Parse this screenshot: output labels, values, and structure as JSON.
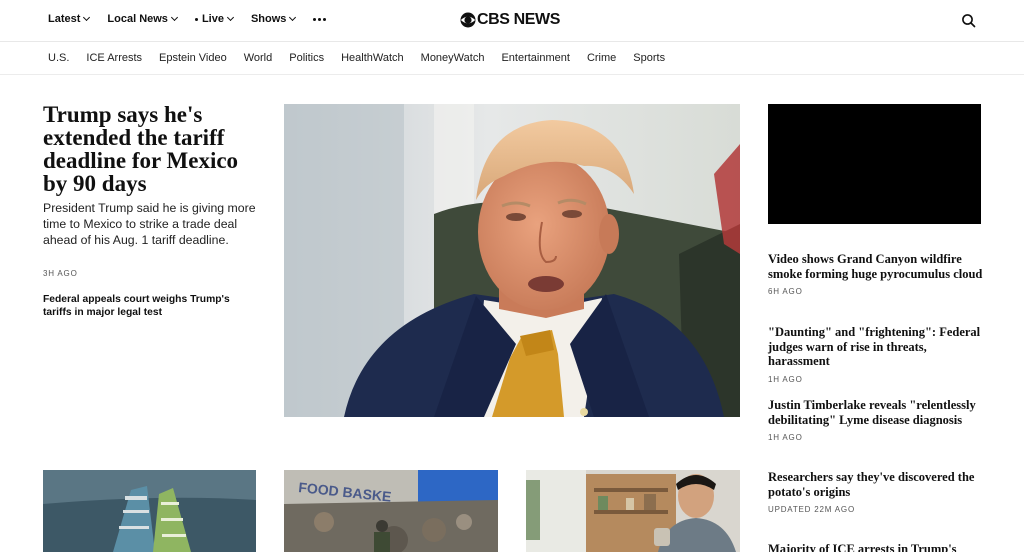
{
  "topnav": {
    "items": [
      {
        "label": "Latest"
      },
      {
        "label": "Local News"
      },
      {
        "label": "Live"
      },
      {
        "label": "Shows"
      }
    ]
  },
  "logo": {
    "text": "CBS NEWS"
  },
  "sections": [
    "U.S.",
    "ICE Arrests",
    "Epstein Video",
    "World",
    "Politics",
    "HealthWatch",
    "MoneyWatch",
    "Entertainment",
    "Crime",
    "Sports"
  ],
  "lead": {
    "headline": "Trump says he's extended the tariff deadline for Mexico by 90 days",
    "dek": "President Trump said he is giving more time to Mexico to strike a trade deal ahead of his Aug. 1 tariff deadline.",
    "time": "3H AGO",
    "related": "Federal appeals court weighs Trump's tariffs in major legal test"
  },
  "rail": [
    {
      "headline": "Video shows Grand Canyon wildfire smoke forming huge pyrocumulus cloud",
      "time": "6H AGO"
    },
    {
      "headline": "\"Daunting\" and \"frightening\": Federal judges warn of rise in threats, harassment",
      "time": "1H AGO"
    },
    {
      "headline": "Justin Timberlake reveals \"relentlessly debilitating\" Lyme disease diagnosis",
      "time": "1H AGO"
    },
    {
      "headline": "Researchers say they've discovered the potato's origins",
      "time": "UPDATED 22M AGO"
    },
    {
      "headline": "Majority of ICE arrests in Trump's"
    }
  ],
  "thumbs": {
    "food_sign": "FOOD BASKE"
  },
  "colors": {
    "text": "#101010",
    "accent_tie": "#d49a2a",
    "suit": "#1e2b4e"
  }
}
